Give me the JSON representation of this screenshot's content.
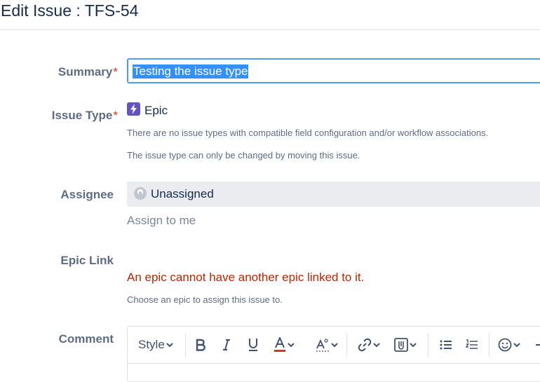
{
  "header": {
    "title": "Edit Issue : TFS-54"
  },
  "summary": {
    "label": "Summary",
    "required_mark": "*",
    "value": "Testing the issue type"
  },
  "issue_type": {
    "label": "Issue Type",
    "required_mark": "*",
    "value": "Epic",
    "icon": "lightning-icon",
    "icon_color": "#6554c0",
    "help1": "There are no issue types with compatible field configuration and/or workflow associations.",
    "help2": "The issue type can only be changed by moving this issue."
  },
  "assignee": {
    "label": "Assignee",
    "value": "Unassigned",
    "assign_to_me": "Assign to me"
  },
  "epic_link": {
    "label": "Epic Link",
    "error": "An epic cannot have another epic linked to it.",
    "error_color": "#bf2600",
    "help": "Choose an epic to assign this issue to."
  },
  "comment": {
    "label": "Comment",
    "toolbar": {
      "style_label": "Style",
      "buttons": [
        "bold-icon",
        "italic-icon",
        "underline-icon",
        "text-color-icon",
        "more-formatting-icon",
        "link-icon",
        "attachment-icon",
        "bullet-list-icon",
        "numbered-list-icon",
        "emoji-icon"
      ]
    }
  },
  "colors": {
    "accent": "#4c9aff",
    "selection": "#3390ff",
    "required": "#de350b"
  }
}
